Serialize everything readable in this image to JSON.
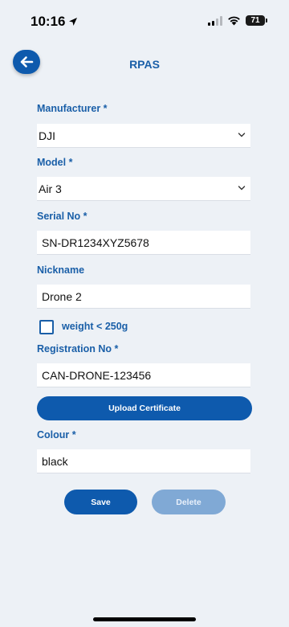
{
  "status_bar": {
    "time": "10:16",
    "battery": "71"
  },
  "header": {
    "title": "RPAS",
    "back_icon": "arrow-left-icon"
  },
  "form": {
    "manufacturer": {
      "label": "Manufacturer *",
      "value": "DJI"
    },
    "model": {
      "label": "Model *",
      "value": "Air 3"
    },
    "serial_no": {
      "label": "Serial No *",
      "value": "SN-DR1234XYZ5678"
    },
    "nickname": {
      "label": "Nickname",
      "value": "Drone 2"
    },
    "weight_checkbox": {
      "label": "weight < 250g",
      "checked": false
    },
    "registration_no": {
      "label": "Registration No *",
      "value": "CAN-DRONE-123456"
    },
    "upload_button": "Upload Certificate",
    "colour": {
      "label": "Colour *",
      "value": "black"
    }
  },
  "actions": {
    "save_label": "Save",
    "delete_label": "Delete"
  },
  "colors": {
    "primary": "#0e5aad",
    "label": "#1a5fa8",
    "disabled": "#80a9d5",
    "background": "#edf1f6"
  }
}
